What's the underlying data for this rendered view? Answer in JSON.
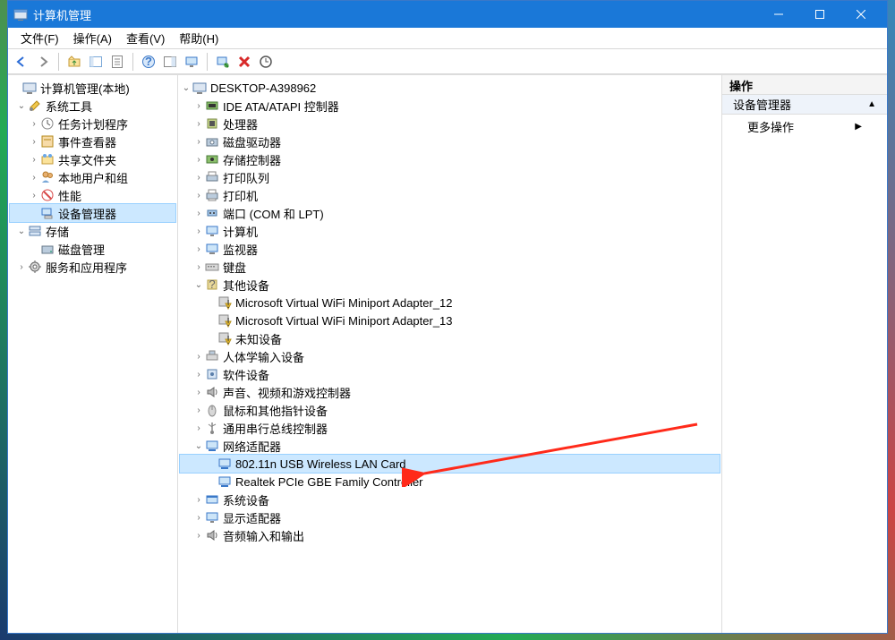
{
  "window": {
    "title": "计算机管理"
  },
  "menu": {
    "file": "文件(F)",
    "actions": "操作(A)",
    "view": "查看(V)",
    "help": "帮助(H)"
  },
  "left_root": "计算机管理(本地)",
  "left_systools": "系统工具",
  "left_sched": "任务计划程序",
  "left_evt": "事件查看器",
  "left_shared": "共享文件夹",
  "left_users": "本地用户和组",
  "left_perf": "性能",
  "left_devmgr": "设备管理器",
  "left_storage": "存储",
  "left_diskmgmt": "磁盘管理",
  "left_services": "服务和应用程序",
  "dev_root": "DESKTOP-A398962",
  "d_ide": "IDE ATA/ATAPI 控制器",
  "d_cpu": "处理器",
  "d_diskdrv": "磁盘驱动器",
  "d_storctrl": "存储控制器",
  "d_pqueue": "打印队列",
  "d_printer": "打印机",
  "d_ports": "端口 (COM 和 LPT)",
  "d_computer": "计算机",
  "d_monitor": "监视器",
  "d_keyboard": "键盘",
  "d_other": "其他设备",
  "d_other1": "Microsoft Virtual WiFi Miniport Adapter_12",
  "d_other2": "Microsoft Virtual WiFi Miniport Adapter_13",
  "d_other3": "未知设备",
  "d_hid": "人体学输入设备",
  "d_soft": "软件设备",
  "d_sound": "声音、视频和游戏控制器",
  "d_mouse": "鼠标和其他指针设备",
  "d_usb": "通用串行总线控制器",
  "d_net": "网络适配器",
  "d_net1": "802.11n USB Wireless LAN Card",
  "d_net2": "Realtek PCIe GBE Family Controller",
  "d_sysdev": "系统设备",
  "d_display": "显示适配器",
  "d_audio": "音频输入和输出",
  "right": {
    "header": "操作",
    "section": "设备管理器",
    "more": "更多操作"
  }
}
